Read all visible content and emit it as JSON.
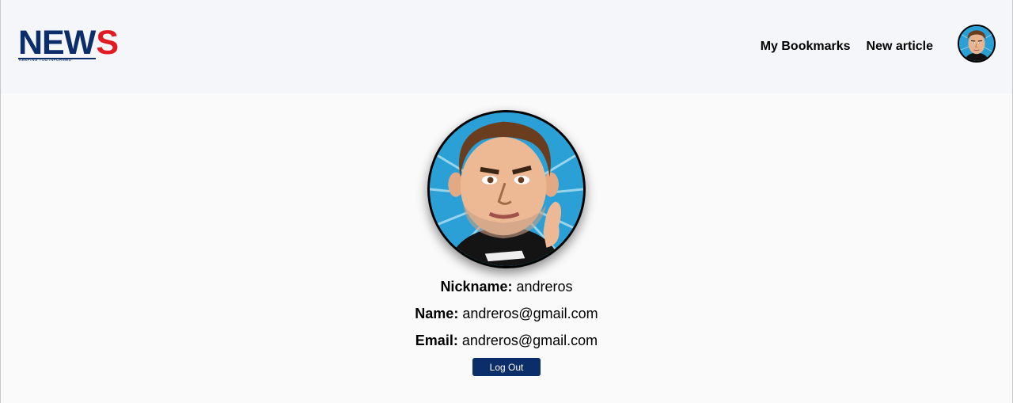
{
  "logo": {
    "word_new": "NEW",
    "word_s": "S",
    "tagline": "KEEPING YOU INFORMED"
  },
  "nav": {
    "bookmarks": "My Bookmarks",
    "new_article": "New article"
  },
  "profile": {
    "nickname_label": "Nickname:",
    "nickname": "andreros",
    "name_label": "Name:",
    "name": "andreros@gmail.com",
    "email_label": "Email:",
    "email": "andreros@gmail.com",
    "logout_label": "Log Out"
  },
  "colors": {
    "brand_navy": "#0b2e6b",
    "brand_red": "#e21b23",
    "avatar_bg": "#2aa0d6"
  },
  "icons": {
    "avatar": "cartoon-user-avatar"
  }
}
